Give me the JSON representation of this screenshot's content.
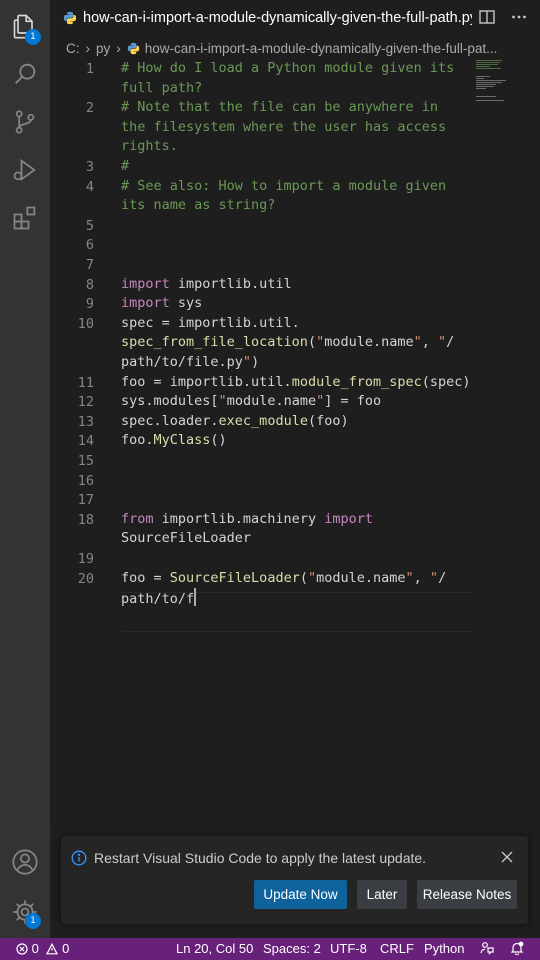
{
  "activity_bar": {
    "explorer_badge": "1",
    "settings_badge": "1"
  },
  "tab": {
    "title": "how-can-i-import-a-module-dynamically-given-the-full-path.py"
  },
  "breadcrumb": {
    "drive": "C:",
    "folder": "py",
    "file": "how-can-i-import-a-module-dynamically-given-the-full-pat..."
  },
  "editor": {
    "lines": [
      {
        "n": "1",
        "text": "# How do I load a Python module given its\nfull path?"
      },
      {
        "n": "2",
        "text": "# Note that the file can be anywhere in\nthe filesystem where the user has access\nrights."
      },
      {
        "n": "3",
        "text": "#"
      },
      {
        "n": "4",
        "text": "# See also: How to import a module given\nits name as string?"
      },
      {
        "n": "5",
        "text": ""
      },
      {
        "n": "6",
        "text": ""
      },
      {
        "n": "7",
        "text": ""
      },
      {
        "n": "8",
        "text": "import importlib.util"
      },
      {
        "n": "9",
        "text": "import sys"
      },
      {
        "n": "10",
        "text": "spec = importlib.util.\nspec_from_file_location(\"module.name\", \"/\npath/to/file.py\")"
      },
      {
        "n": "11",
        "text": "foo = importlib.util.module_from_spec(spec)"
      },
      {
        "n": "12",
        "text": "sys.modules[\"module.name\"] = foo"
      },
      {
        "n": "13",
        "text": "spec.loader.exec_module(foo)"
      },
      {
        "n": "14",
        "text": "foo.MyClass()"
      },
      {
        "n": "15",
        "text": ""
      },
      {
        "n": "16",
        "text": ""
      },
      {
        "n": "17",
        "text": ""
      },
      {
        "n": "18",
        "text": "from importlib.machinery import\nSourceFileLoader"
      },
      {
        "n": "19",
        "text": ""
      },
      {
        "n": "20",
        "text": "foo = SourceFileLoader(\"module.name\", \"/\npath/to/f"
      }
    ]
  },
  "notification": {
    "message": "Restart Visual Studio Code to apply the latest update.",
    "update_now": "Update Now",
    "later": "Later",
    "release_notes": "Release Notes"
  },
  "status_bar": {
    "errors": "0",
    "warnings": "0",
    "position": "Ln 20, Col 50",
    "spaces": "Spaces: 2",
    "encoding": "UTF-8",
    "eol": "CRLF",
    "language": "Python"
  },
  "colors": {
    "status_bar": "#68217a",
    "accent": "#0078d4",
    "primary_button": "#0e639c",
    "comment": "#6a9955",
    "keyword": "#c586c0",
    "function": "#dcdcaa",
    "string": "#ce9178"
  }
}
